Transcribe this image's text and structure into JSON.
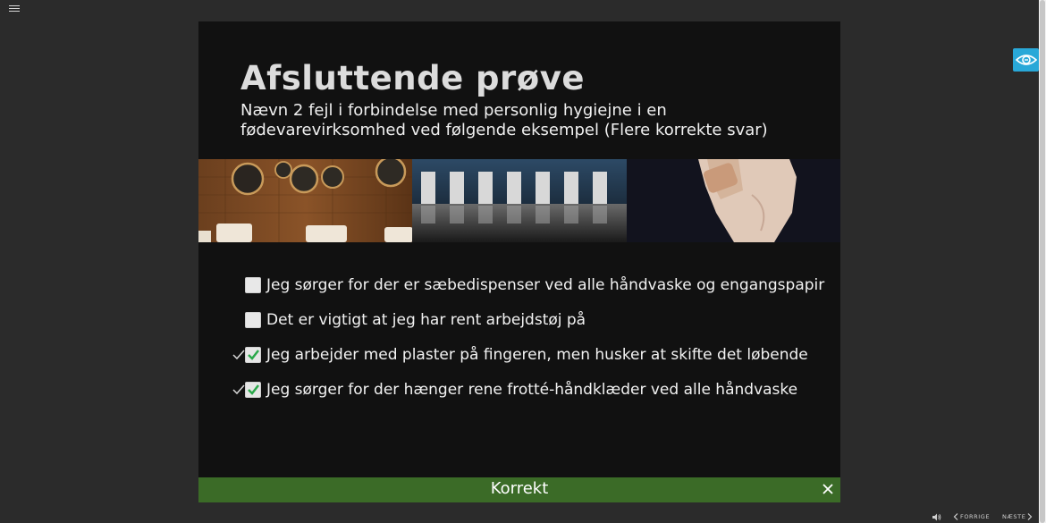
{
  "slide": {
    "title": "Afsluttende prøve",
    "question": "Nævn 2 fejl i forbindelse med personlig hygiejne i en fødevarevirksomhed ved følgende eksempel (Flere korrekte svar)"
  },
  "options": [
    {
      "label": "Jeg sørger for der er sæbedispenser ved alle håndvaske og engangspapir",
      "checked": false,
      "correct_mark": false
    },
    {
      "label": "Det er vigtigt at jeg har rent arbejdstøj på",
      "checked": false,
      "correct_mark": false
    },
    {
      "label": "Jeg arbejder med plaster på fingeren, men husker at skifte det løbende",
      "checked": true,
      "correct_mark": true
    },
    {
      "label": "Jeg sørger for der hænger rene frotté-håndklæder ved alle håndvaske",
      "checked": true,
      "correct_mark": true
    }
  ],
  "feedback": {
    "text": "Korrekt",
    "color": "#3b6b27"
  },
  "nav": {
    "previous_label": "FORRIGE",
    "next_label": "NÆSTE"
  },
  "icons": {
    "menu": "hamburger-icon",
    "accessibility": "eye-icon",
    "sound": "speaker-icon",
    "close": "close-icon",
    "check": "checkmark-icon"
  },
  "colors": {
    "accent": "#29a8d8",
    "feedback_bg": "#3b6b27",
    "slide_bg": "#111111",
    "page_bg": "#2b2b2b"
  }
}
